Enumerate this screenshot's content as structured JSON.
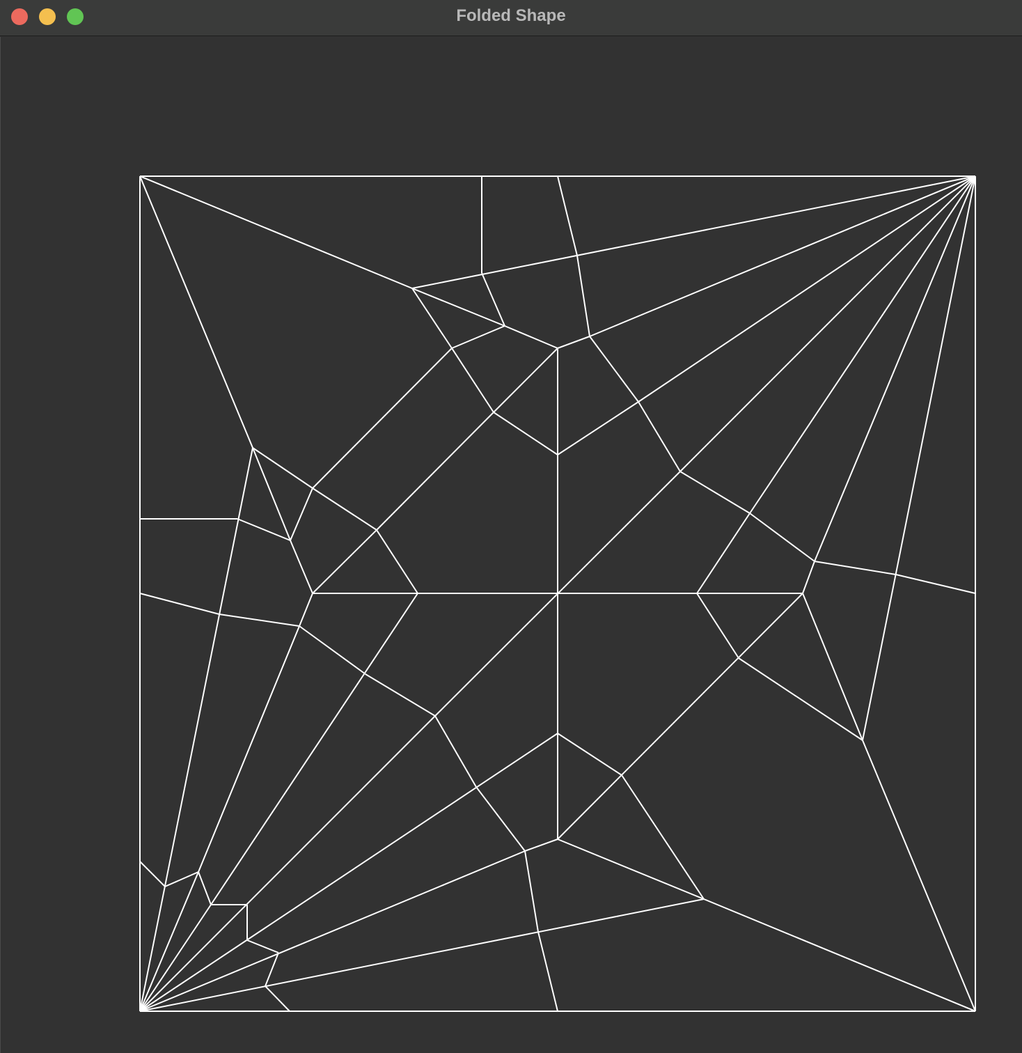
{
  "window": {
    "title": "Folded Shape",
    "controls": [
      "close",
      "minimize",
      "maximize"
    ],
    "colors": {
      "close": "#ec6a5e",
      "minimize": "#f4bf4f",
      "maximize": "#61c554",
      "background": "#323232",
      "line": "#ffffff"
    }
  }
}
